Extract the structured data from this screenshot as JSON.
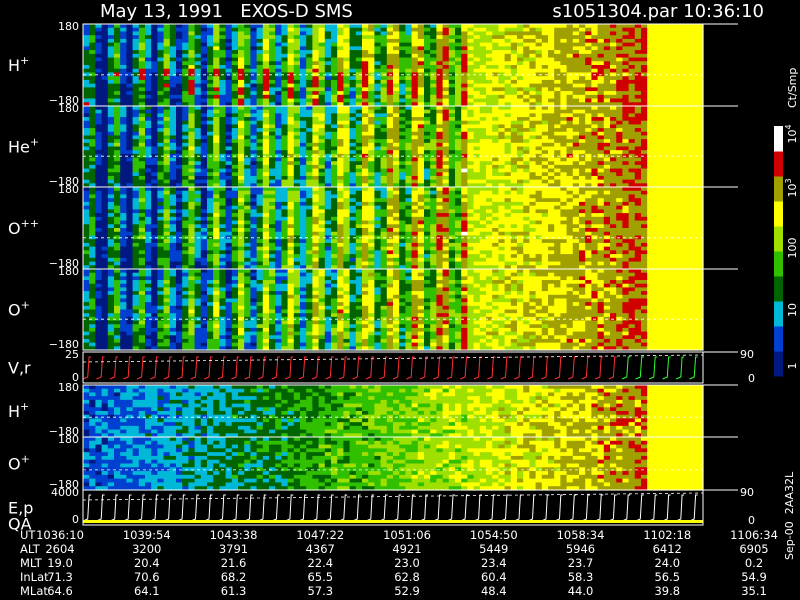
{
  "header": {
    "left_title": "May 13, 1991   EXOS-D SMS",
    "right_title": "s1051304.par  10:36:10"
  },
  "chart_data": {
    "type": "heatmap",
    "instrument": "EXOS-D SMS",
    "date": "May 13, 1991",
    "file": "s1051304.par",
    "time": "10:36:10",
    "colorbar": {
      "unit": "Ct/Smp",
      "tick_labels": [
        "1",
        "10",
        "100",
        "10^3",
        "10^4"
      ],
      "scale": "log",
      "colors": [
        "#001880",
        "#0040d0",
        "#00b8d8",
        "#006400",
        "#30c000",
        "#a0e000",
        "#ffff00",
        "#a0a000",
        "#d00000",
        "#ffffff"
      ]
    },
    "panels": [
      {
        "id": "H+",
        "label": "H",
        "sup": "+",
        "ytick_top": "180",
        "ytick_bottom": "−180"
      },
      {
        "id": "He+",
        "label": "He",
        "sup": "+",
        "ytick_top": "180",
        "ytick_bottom": "−180"
      },
      {
        "id": "O++",
        "label": "O",
        "sup": "++",
        "ytick_top": "180",
        "ytick_bottom": "−180"
      },
      {
        "id": "O+",
        "label": "O",
        "sup": "+",
        "ytick_top": "180",
        "ytick_bottom": "−180"
      },
      {
        "id": "Vr",
        "label": "V,r",
        "sup": "",
        "ytick_top": "25",
        "ytick_bottom": "0",
        "right_top": "90",
        "right_bottom": "0",
        "type": "line"
      },
      {
        "id": "H+2",
        "label": "H",
        "sup": "+",
        "ytick_top": "180",
        "ytick_bottom": "−180"
      },
      {
        "id": "O+2",
        "label": "O",
        "sup": "+",
        "ytick_top": "180",
        "ytick_bottom": "−180"
      },
      {
        "id": "EpQA",
        "label": "E,p",
        "label2": "QA",
        "ytick_top": "4000",
        "ytick_bottom": "0",
        "right_top": "90",
        "right_bottom": "0",
        "type": "line"
      }
    ],
    "x_axis": {
      "row_labels": [
        "UT",
        "ALT",
        "MLT",
        "InLat",
        "MLat"
      ],
      "ticks": [
        {
          "UT": "1036:10",
          "ALT": "2604",
          "MLT": "19.0",
          "InLat": "71.3",
          "MLat": "64.6"
        },
        {
          "UT": "1039:54",
          "ALT": "3200",
          "MLT": "20.4",
          "InLat": "70.6",
          "MLat": "64.1"
        },
        {
          "UT": "1043:38",
          "ALT": "3791",
          "MLT": "21.6",
          "InLat": "68.2",
          "MLat": "61.3"
        },
        {
          "UT": "1047:22",
          "ALT": "4367",
          "MLT": "22.4",
          "InLat": "65.5",
          "MLat": "57.3"
        },
        {
          "UT": "1051:06",
          "ALT": "4921",
          "MLT": "23.0",
          "InLat": "62.8",
          "MLat": "52.9"
        },
        {
          "UT": "1054:50",
          "ALT": "5449",
          "MLT": "23.4",
          "InLat": "60.4",
          "MLat": "48.4"
        },
        {
          "UT": "1058:34",
          "ALT": "5946",
          "MLT": "23.7",
          "InLat": "58.3",
          "MLat": "44.0"
        },
        {
          "UT": "1102:18",
          "ALT": "6412",
          "MLT": "24.0",
          "InLat": "56.5",
          "MLat": "39.8"
        },
        {
          "UT": "1106:34",
          "ALT": "6905",
          "MLT": "0.2",
          "InLat": "54.9",
          "MLat": "35.1"
        }
      ]
    },
    "side_label": "Sep-00  2AA32L"
  }
}
